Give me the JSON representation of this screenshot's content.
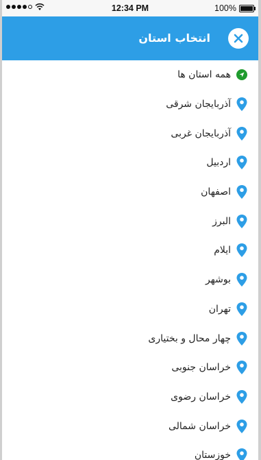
{
  "status_bar": {
    "time": "12:34 PM",
    "battery": "100%"
  },
  "header": {
    "title": "انتخاب استان"
  },
  "colors": {
    "header": "#2d9ee6",
    "pin": "#2d9ee6",
    "all_icon": "#1f9b2e"
  },
  "provinces": [
    {
      "label": "همه استان ها",
      "icon": "navigation-arrow-icon"
    },
    {
      "label": "آذربایجان شرقی",
      "icon": "location-pin-icon"
    },
    {
      "label": "آذربایجان غربی",
      "icon": "location-pin-icon"
    },
    {
      "label": "اردبیل",
      "icon": "location-pin-icon"
    },
    {
      "label": "اصفهان",
      "icon": "location-pin-icon"
    },
    {
      "label": "البرز",
      "icon": "location-pin-icon"
    },
    {
      "label": "ایلام",
      "icon": "location-pin-icon"
    },
    {
      "label": "بوشهر",
      "icon": "location-pin-icon"
    },
    {
      "label": "تهران",
      "icon": "location-pin-icon"
    },
    {
      "label": "چهار محال و بختیاری",
      "icon": "location-pin-icon"
    },
    {
      "label": "خراسان جنوبی",
      "icon": "location-pin-icon"
    },
    {
      "label": "خراسان رضوی",
      "icon": "location-pin-icon"
    },
    {
      "label": "خراسان شمالی",
      "icon": "location-pin-icon"
    },
    {
      "label": "خوزستان",
      "icon": "location-pin-icon"
    }
  ]
}
